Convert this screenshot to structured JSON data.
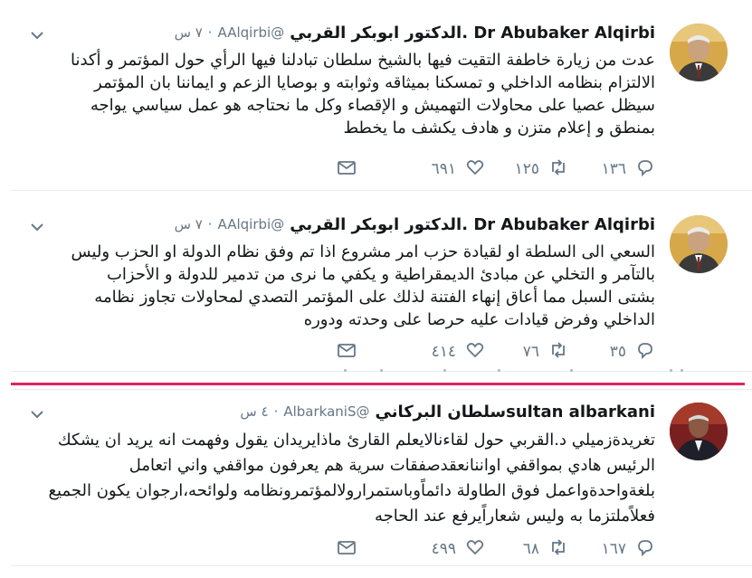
{
  "tweets": [
    {
      "name": "Dr Abubaker Alqirbi .الدكتور ابوبكر القربي",
      "handle": "@AAlqirbi",
      "time": "٧ س",
      "text": "عدت من زيارة خاطفة التقيت فيها بالشيخ سلطان تبادلنا فيها الرأي حول المؤتمر و أكدنا\nالالتزام بنظامه الداخلي و تمسكنا بميثاقه وثوابته و بوصايا الزعم و ايماننا بان المؤتمر\nسيظل عصيا على محاولات التهميش و الإقصاء وكل ما نحتاجه هو عمل سياسي يواجه\nبمنطق و إعلام متزن و هادف يكشف ما يخطط",
      "replies": "١٣٦",
      "retweets": "١٢٥",
      "likes": "٦٩١"
    },
    {
      "name": "Dr Abubaker Alqirbi .الدكتور ابوبكر القربي",
      "handle": "@AAlqirbi",
      "time": "٧ س",
      "text": "السعي الى السلطة او لقيادة حزب امر مشروع اذا تم وفق نظام الدولة او الحزب وليس\nبالتآمر و التخلي عن  مبادئ الديمقراطية و يكفي ما نرى من تدمير للدولة و الأحزاب\nبشتى السبل مما أعاق إنهاء الفتنة لذلك على المؤتمر التصدي لمحاولات تجاوز نظامه\nالداخلي وفرض قيادات عليه حرصا على وحدته ودوره",
      "replies": "٣٥",
      "retweets": "٧٦",
      "likes": "٤١٤"
    },
    {
      "name": "sultan albarkaniسلطان البركاني",
      "handle": "@AlbarkaniS",
      "time": "٤ س",
      "text": "تغريدةزميلي د.القربي حول لقاءنالايعلم القارئ ماذايريدان يقول وفهمت انه يريد ان يشكك\nالرئيس هادي بمواقفي اواننانعقدصفقات سرية هم يعرفون مواقفي واني اتعامل\nبلغةواحدةواعمل فوق الطاولة دائماًوباستمرارولالمؤتمرونظامه ولوائحه،ارجوان يكون الجميع\nفعلاًملتزما به وليس شعاراًيرفع عند الحاجه",
      "replies": "١٦٧",
      "retweets": "٦٨",
      "likes": "٤٩٩"
    }
  ],
  "icons": {
    "reply": "reply-icon",
    "retweet": "retweet-icon",
    "like": "heart-icon",
    "message": "envelope-icon",
    "menu": "chevron-down-icon"
  },
  "colors": {
    "text": "#14171a",
    "secondary": "#657786",
    "divider": "#e0245e",
    "border": "#e6ecf0"
  }
}
